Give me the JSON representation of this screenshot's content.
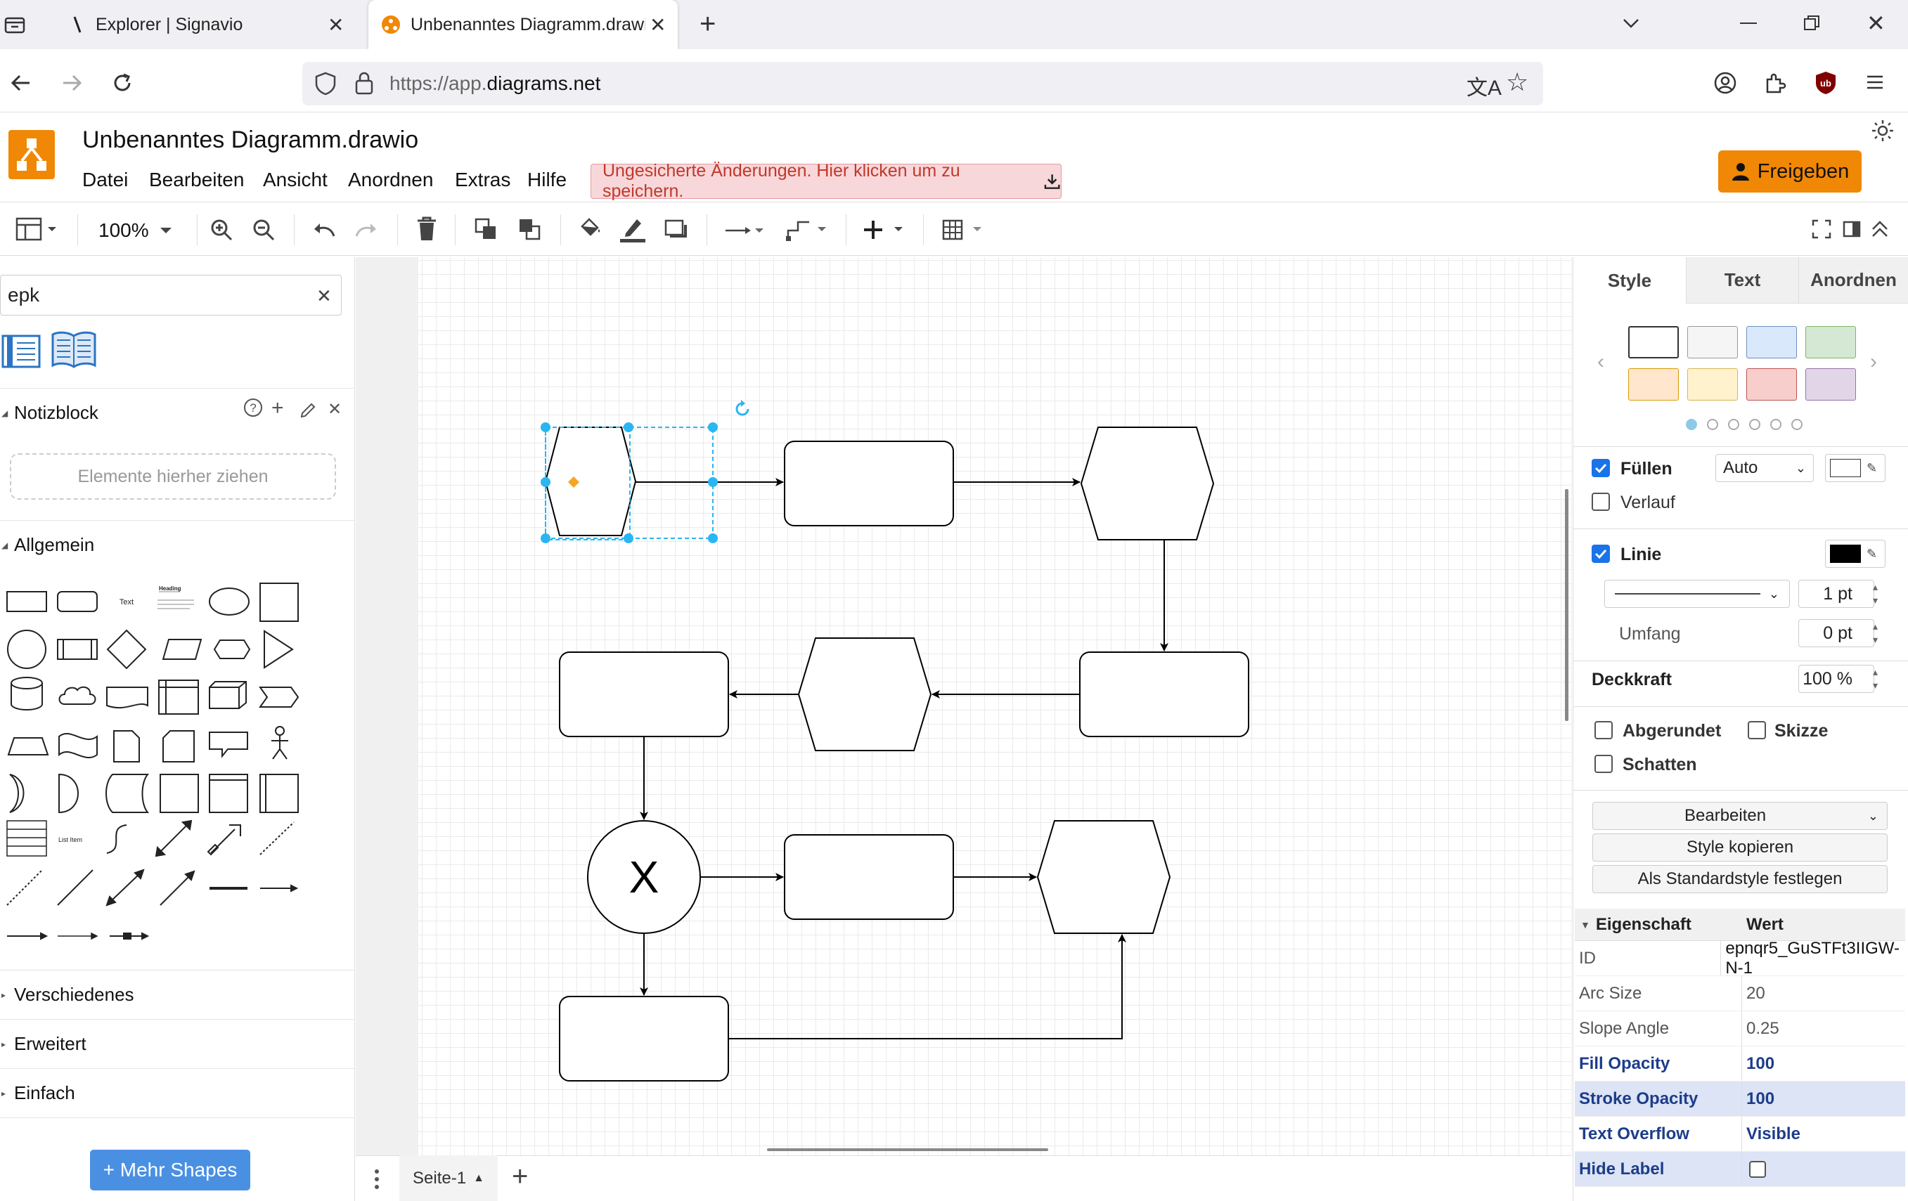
{
  "browser": {
    "tabs": [
      {
        "label": "Explorer | Signavio",
        "active": false
      },
      {
        "label": "Unbenanntes Diagramm.drawio",
        "active": true
      }
    ],
    "url_prefix": "https://app.",
    "url_domain": "diagrams.net"
  },
  "app": {
    "title": "Unbenanntes Diagramm.drawio",
    "menu": [
      "Datei",
      "Bearbeiten",
      "Ansicht",
      "Anordnen",
      "Extras",
      "Hilfe"
    ],
    "unsaved_notice": "Ungesicherte Änderungen. Hier klicken um zu speichern.",
    "share_label": "Freigeben",
    "accent_color": "#f08705"
  },
  "toolbar": {
    "zoom": "100%"
  },
  "left_panel": {
    "search_value": "epk",
    "scratchpad_title": "Notizblock",
    "dropzone_text": "Elemente hierher ziehen",
    "section_general": "Allgemein",
    "shape_text_label": "Text",
    "shape_heading_label": "Heading",
    "shape_listitem_label": "List Item",
    "collapsed_sections": [
      "Verschiedenes",
      "Erweitert",
      "Einfach"
    ],
    "more_shapes_label": "+ Mehr Shapes"
  },
  "canvas": {
    "decision_symbol": "X"
  },
  "bottom": {
    "page_tab": "Seite-1"
  },
  "right_panel": {
    "tabs": [
      "Style",
      "Text",
      "Anordnen"
    ],
    "active_tab": "Style",
    "swatch_colors": [
      "#ffffff",
      "#f5f5f5",
      "#dae8fc",
      "#d5e8d4",
      "#ffe6cc",
      "#fff2cc",
      "#f8cecc",
      "#e1d5e7"
    ],
    "fill": {
      "label": "Füllen",
      "checked": true,
      "mode": "Auto"
    },
    "gradient": {
      "label": "Verlauf",
      "checked": false
    },
    "line": {
      "label": "Linie",
      "checked": true,
      "width": "1 pt"
    },
    "perimeter": {
      "label": "Umfang",
      "value": "0 pt"
    },
    "opacity": {
      "label": "Deckkraft",
      "value": "100 %"
    },
    "options": {
      "rounded": "Abgerundet",
      "sketch": "Skizze",
      "shadow": "Schatten"
    },
    "buttons": {
      "edit": "Bearbeiten",
      "copy_style": "Style kopieren",
      "set_default": "Als Standardstyle festlegen"
    },
    "props_header": {
      "key": "Eigenschaft",
      "value": "Wert"
    },
    "props": [
      {
        "key": "ID",
        "value": "epnqr5_GuSTFt3IIGW-N-1"
      },
      {
        "key": "Arc Size",
        "value": "20"
      },
      {
        "key": "Slope Angle",
        "value": "0.25"
      },
      {
        "key": "Fill Opacity",
        "value": "100"
      },
      {
        "key": "Stroke Opacity",
        "value": "100"
      },
      {
        "key": "Text Overflow",
        "value": "Visible"
      },
      {
        "key": "Hide Label",
        "value": ""
      }
    ]
  }
}
